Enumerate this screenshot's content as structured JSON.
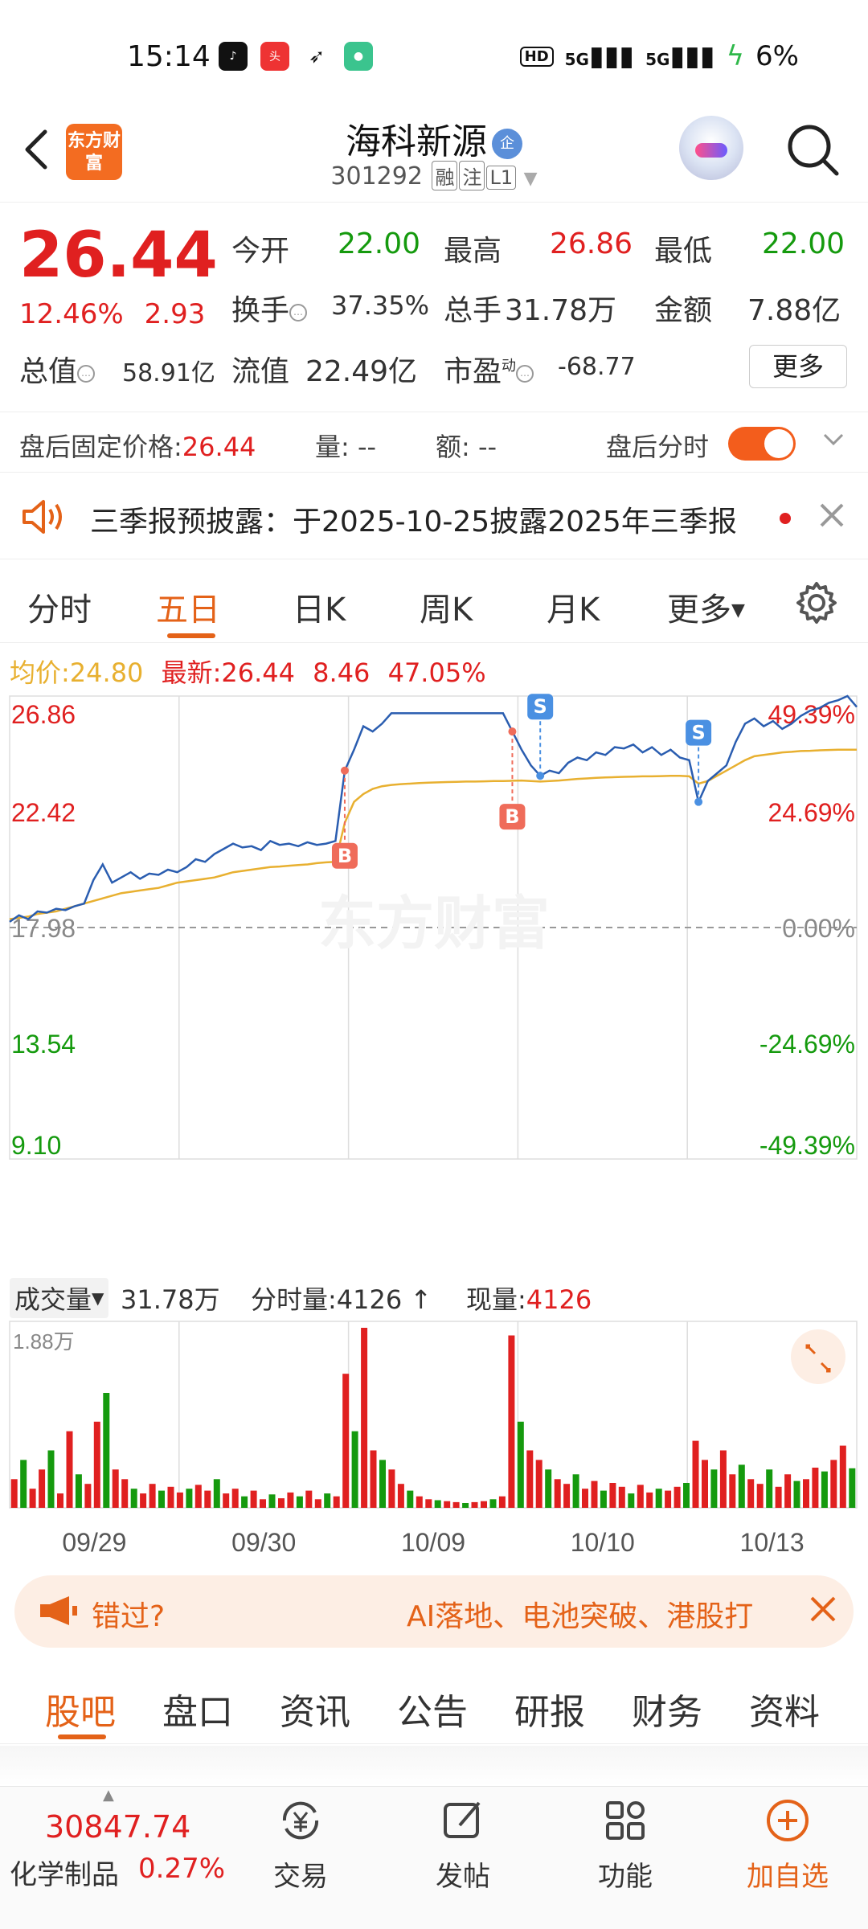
{
  "status_bar": {
    "time": "15:14",
    "apps": [
      "douyin-app-icon",
      "toutiao-app-icon",
      "feather-app-icon",
      "chat-app-icon"
    ],
    "hd": "HD",
    "sig1": "5G",
    "sig2": "5G",
    "battery": "6%"
  },
  "header": {
    "logo": "东方财富",
    "name": "海科新源",
    "badge": "企",
    "code": "301292",
    "tags": [
      "融",
      "注",
      "L1"
    ]
  },
  "quote": {
    "price": "26.44",
    "change_pct": "12.46%",
    "change_amt": "2.93",
    "open_label": "今开",
    "open": "22.00",
    "high_label": "最高",
    "high": "26.86",
    "low_label": "最低",
    "low": "22.00",
    "turnover_label": "换手",
    "turnover": "37.35%",
    "vol_label": "总手",
    "vol": "31.78万",
    "amount_label": "金额",
    "amount": "7.88亿",
    "mcap_label": "总值",
    "mcap": "58.91亿",
    "float_label": "流值",
    "float": "22.49亿",
    "pe_label": "市盈",
    "pe_sup": "动",
    "pe": "-68.77",
    "more": "更多"
  },
  "after_hours": {
    "price_label": "盘后固定价格:",
    "price": "26.44",
    "vol_label": "量:",
    "vol": "--",
    "amt_label": "额:",
    "amt": "--",
    "toggle_label": "盘后分时",
    "toggle_on": true
  },
  "notice": {
    "text": "三季报预披露：于2025-10-25披露2025年三季报"
  },
  "chart_tabs": [
    "分时",
    "五日",
    "日K",
    "周K",
    "月K",
    "更多"
  ],
  "active_chart_tab": "五日",
  "avg_line": {
    "avg_label": "均价:",
    "avg": "24.80",
    "latest_label": "最新:",
    "latest": "26.44",
    "chg": "8.46",
    "pct": "47.05%"
  },
  "chart_data": {
    "type": "line",
    "title": "",
    "x_ticks": [
      "09/29",
      "09/30",
      "10/09",
      "10/10",
      "10/13"
    ],
    "y_left_ticks": [
      "26.86",
      "22.42",
      "17.98",
      "13.54",
      "9.10"
    ],
    "y_right_ticks": [
      "49.39%",
      "24.69%",
      "0.00%",
      "-24.69%",
      "-49.39%"
    ],
    "ylim": [
      9.1,
      26.86
    ],
    "base_price": 17.98,
    "series": [
      {
        "name": "",
        "values": [
          18.2,
          18.45,
          18.3,
          18.6,
          18.55,
          18.7,
          18.65,
          18.8,
          18.9,
          19.8,
          20.4,
          19.7,
          19.9,
          20.1,
          19.85,
          20.05,
          20.0,
          20.2,
          20.1,
          20.3,
          20.6,
          20.5,
          20.8,
          21.0,
          21.2,
          21.05,
          21.1,
          20.95,
          21.3,
          21.15,
          21.2,
          21.1,
          21.25,
          21.15,
          21.2,
          21.3,
          24.0,
          24.8,
          25.7,
          25.5,
          25.8,
          26.2,
          26.2,
          26.2,
          26.2,
          26.2,
          26.2,
          26.2,
          26.2,
          26.2,
          26.2,
          26.2,
          26.2,
          26.2,
          25.5,
          24.8,
          24.2,
          23.8,
          24.0,
          23.9,
          24.3,
          24.5,
          24.4,
          24.7,
          24.6,
          24.9,
          24.85,
          25.0,
          24.7,
          24.9,
          24.6,
          24.8,
          24.5,
          24.4,
          22.8,
          23.6,
          23.9,
          24.2,
          25.1,
          25.8,
          26.0,
          25.7,
          25.9,
          25.6,
          25.8,
          26.1,
          26.3,
          26.4,
          26.6,
          26.7,
          26.86,
          26.44
        ]
      },
      {
        "name": "",
        "values": [
          18.3,
          18.35,
          18.4,
          18.5,
          18.55,
          18.6,
          18.7,
          18.8,
          18.9,
          19.0,
          19.1,
          19.2,
          19.3,
          19.35,
          19.4,
          19.45,
          19.5,
          19.6,
          19.7,
          19.75,
          19.8,
          19.85,
          19.9,
          20.0,
          20.1,
          20.15,
          20.2,
          20.25,
          20.3,
          20.32,
          20.35,
          20.38,
          20.4,
          20.45,
          20.48,
          20.5,
          22.0,
          22.8,
          23.1,
          23.3,
          23.4,
          23.45,
          23.48,
          23.5,
          23.52,
          23.54,
          23.55,
          23.56,
          23.57,
          23.58,
          23.58,
          23.59,
          23.6,
          23.6,
          23.61,
          23.62,
          23.6,
          23.58,
          23.6,
          23.62,
          23.65,
          23.68,
          23.7,
          23.72,
          23.74,
          23.75,
          23.76,
          23.77,
          23.78,
          23.78,
          23.79,
          23.8,
          23.8,
          23.78,
          23.5,
          23.6,
          23.8,
          24.0,
          24.2,
          24.4,
          24.55,
          24.6,
          24.65,
          24.7,
          24.72,
          24.75,
          24.76,
          24.78,
          24.79,
          24.8,
          24.8,
          24.8
        ]
      }
    ],
    "trade_marks": [
      "B",
      "B",
      "S",
      "S"
    ],
    "watermark": "东方财富"
  },
  "volume": {
    "label": "成交量",
    "total": "31.78万",
    "tick_label": "分时量:",
    "tick": "4126",
    "now_label": "现量:",
    "now": "4126",
    "max_tick": "1.88万",
    "max_value": 18800,
    "bars": [
      3000,
      5000,
      2000,
      4000,
      6000,
      1500,
      8000,
      3500,
      2500,
      9000,
      12000,
      4000,
      3000,
      2000,
      1500,
      2500,
      1800,
      2200,
      1600,
      2000,
      2400,
      1800,
      3000,
      1500,
      2000,
      1200,
      1800,
      900,
      1400,
      1000,
      1600,
      1200,
      1800,
      900,
      1500,
      1200,
      14000,
      8000,
      18800,
      6000,
      5000,
      4000,
      2500,
      1800,
      1200,
      900,
      800,
      700,
      600,
      500,
      600,
      700,
      900,
      1200,
      18000,
      9000,
      6000,
      5000,
      4000,
      3000,
      2500,
      3500,
      2000,
      2800,
      1800,
      2600,
      2200,
      1500,
      2400,
      1600,
      2000,
      1800,
      2200,
      2600,
      7000,
      5000,
      4000,
      6000,
      3500,
      4500,
      3000,
      2500,
      4000,
      2200,
      3500,
      2800,
      3000,
      4200,
      3800,
      5000,
      6500,
      4126
    ]
  },
  "promo": {
    "t1": "错过?",
    "t2": "AI落地、电池突破、港股打"
  },
  "sub_tabs": [
    "股吧",
    "盘口",
    "资讯",
    "公告",
    "研报",
    "财务",
    "资料"
  ],
  "active_sub_tab": "股吧",
  "bottom": {
    "index_value": "30847.74",
    "index_name": "化学制品",
    "index_pct": "0.27%",
    "nav": [
      {
        "label": "交易",
        "icon": "yuan-exchange-icon"
      },
      {
        "label": "发帖",
        "icon": "edit-icon"
      },
      {
        "label": "功能",
        "icon": "grid-icon"
      },
      {
        "label": "加自选",
        "icon": "add-circle-icon"
      }
    ]
  },
  "colors": {
    "up": "#e02020",
    "down": "#159a0e",
    "accent": "#e46218",
    "avg_line": "#e8b030",
    "price_line": "#2a5db0"
  }
}
